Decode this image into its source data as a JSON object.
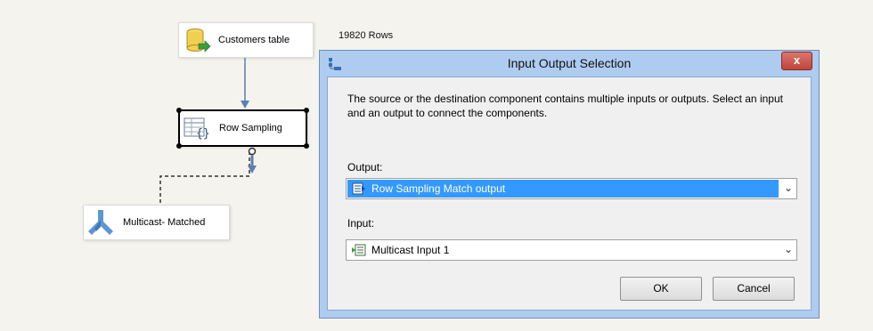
{
  "canvas": {
    "nodes": {
      "customers": {
        "label": "Customers table",
        "icon": "database-source-icon"
      },
      "row_sampling": {
        "label": "Row Sampling",
        "icon": "row-sampling-icon"
      },
      "multicast": {
        "label": "Multicast- Matched",
        "icon": "multicast-icon"
      }
    },
    "path_annotation": "19820 Rows"
  },
  "dialog": {
    "title": "Input Output Selection",
    "close_label": "x",
    "description": "The source or the destination component contains multiple inputs or outputs. Select an input and an output to connect the components.",
    "output_label": "Output:",
    "output_value": "Row Sampling Match output",
    "input_label": "Input:",
    "input_value": "Multicast Input 1",
    "ok_label": "OK",
    "cancel_label": "Cancel"
  },
  "colors": {
    "selection": "#3399ff",
    "dialog_frame": "#aeccf0",
    "close_button": "#c7473d",
    "canvas_background": "#f5f3ee"
  }
}
